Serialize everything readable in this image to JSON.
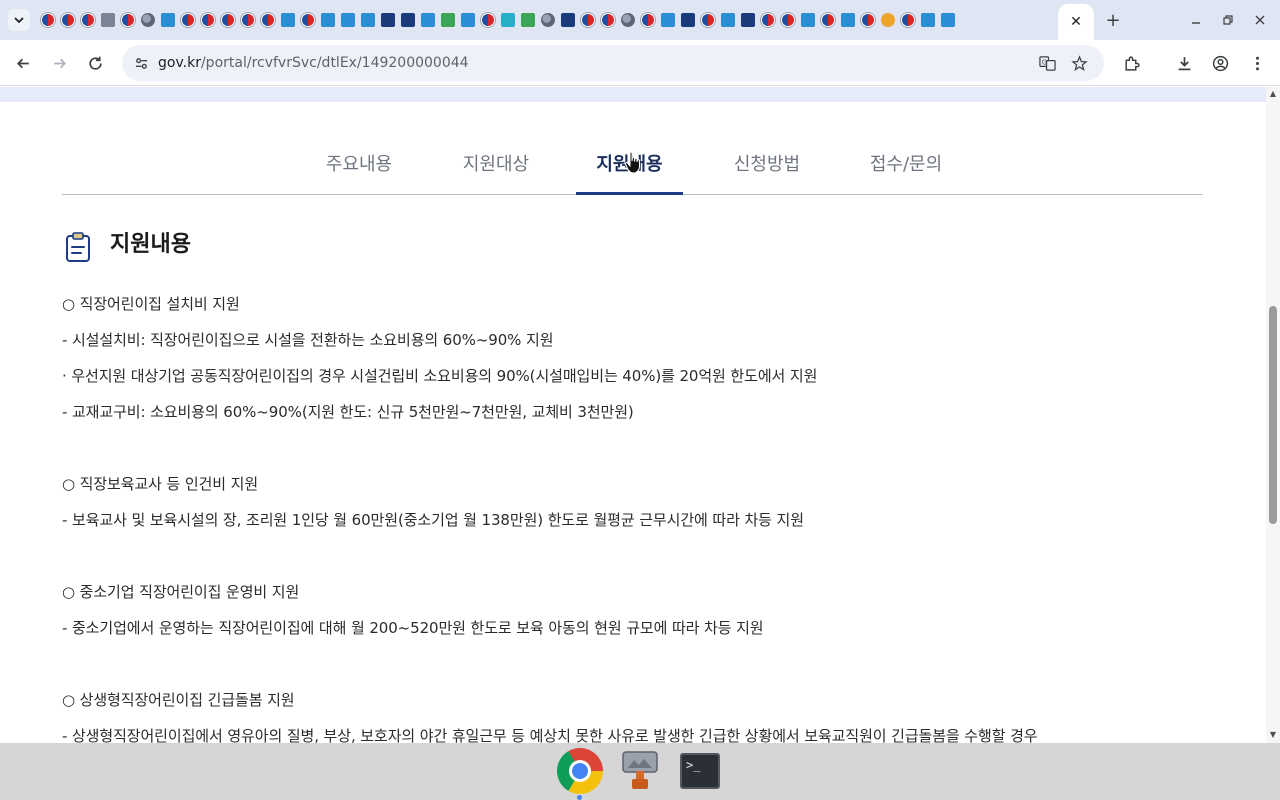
{
  "browser": {
    "url_host": "gov.kr",
    "url_path": "/portal/rcvfvrSvc/dtlEx/149200000044",
    "close_tab_glyph": "✕",
    "new_tab_glyph": "+",
    "pinned_favicons": [
      "gov",
      "gov",
      "gov",
      "gray",
      "gov",
      "globe",
      "blue",
      "gov",
      "gov",
      "gov",
      "gov",
      "gov",
      "blue",
      "gov",
      "blue",
      "blue",
      "blue",
      "navy",
      "navy",
      "blue",
      "green",
      "blue",
      "gov",
      "cyan",
      "green",
      "globe",
      "navy",
      "gov",
      "gov",
      "globe",
      "gov",
      "blue",
      "navy",
      "gov",
      "blue",
      "navy",
      "gov",
      "gov",
      "blue",
      "gov",
      "blue",
      "gov",
      "orange",
      "gov",
      "blue",
      "blue"
    ]
  },
  "page": {
    "nav_tabs": [
      {
        "label": "주요내용",
        "active": false
      },
      {
        "label": "지원대상",
        "active": false
      },
      {
        "label": "지원내용",
        "active": true
      },
      {
        "label": "신청방법",
        "active": false
      },
      {
        "label": "접수/문의",
        "active": false
      }
    ],
    "section_title": "지원내용",
    "paragraphs": [
      "○ 직장어린이집 설치비 지원",
      "- 시설설치비: 직장어린이집으로 시설을 전환하는 소요비용의 60%~90% 지원",
      "· 우선지원 대상기업 공동직장어린이집의 경우 시설건립비 소요비용의 90%(시설매입비는 40%)를 20억원 한도에서 지원",
      "- 교재교구비: 소요비용의 60%~90%(지원 한도: 신규 5천만원~7천만원, 교체비 3천만원)",
      "",
      "○ 직장보육교사 등 인건비 지원",
      "- 보육교사 및 보육시설의 장, 조리원 1인당 월 60만원(중소기업 월 138만원) 한도로 월평균 근무시간에 따라 차등 지원",
      "",
      "○ 중소기업 직장어린이집 운영비 지원",
      "- 중소기업에서 운영하는 직장어린이집에 대해 월 200~520만원 한도로 보육 아동의 현원 규모에 따라 차등 지원",
      "",
      "○ 상생형직장어린이집 긴급돌봄 지원",
      "- 상생형직장어린이집에서 영유아의 질병, 부상, 보호자의 야간 휴일근무 등 예상치 못한 사유로 발생한 긴급한 상황에서 보육교직원이 긴급돌봄을 수행할 경우"
    ]
  },
  "taskbar": {
    "apps": [
      "chrome-app",
      "image-viewer-app",
      "terminal-app"
    ],
    "terminal_glyph": ">_"
  }
}
